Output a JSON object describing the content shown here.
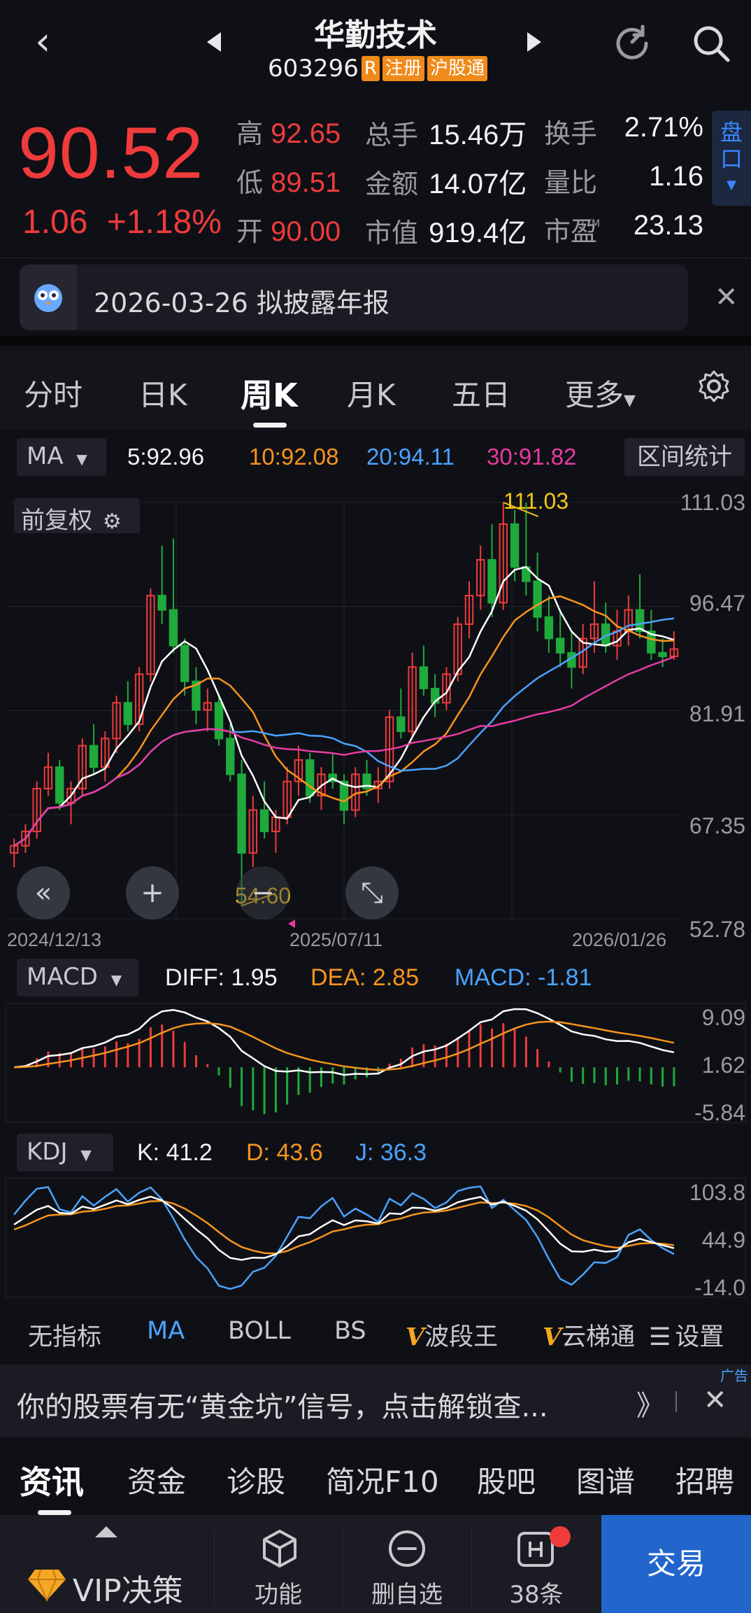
{
  "header": {
    "stock_name": "华勤技术",
    "stock_code": "603296",
    "badges": {
      "r": "R",
      "reg": "注册",
      "hk": "沪股通"
    }
  },
  "quote": {
    "price": "90.52",
    "change": "1.06",
    "change_pct": "+1.18%",
    "high_label": "高",
    "high": "92.65",
    "low_label": "低",
    "low": "89.51",
    "open_label": "开",
    "open": "90.00",
    "volume_label": "总手",
    "volume": "15.46万",
    "amount_label": "金额",
    "amount": "14.07亿",
    "mcap_label": "市值",
    "mcap": "919.4亿",
    "turnover_label": "换手",
    "turnover": "2.71%",
    "vol_ratio_label": "量比",
    "vol_ratio": "1.16",
    "pe_label": "市盈",
    "pe_sup": "TTM",
    "pe": "23.13",
    "pankou": "盘口"
  },
  "notice": {
    "text": "2026-03-26 拟披露年报"
  },
  "chart_tabs": [
    "分时",
    "日K",
    "周K",
    "月K",
    "五日",
    "更多"
  ],
  "active_tab": "周K",
  "ma": {
    "select": "MA",
    "ma5": "5:92.96",
    "ma10": "10:92.08",
    "ma20": "20:94.11",
    "ma30": "30:91.82",
    "range_stat": "区间统计"
  },
  "kline": {
    "adjust_label": "前复权",
    "price_ticks": [
      "111.03",
      "96.47",
      "81.91",
      "67.35",
      "52.78"
    ],
    "dates": [
      "2024/12/13",
      "2025/07/11",
      "2026/01/26"
    ],
    "max_label": "111.03",
    "min_label": "54.60"
  },
  "macd": {
    "select": "MACD",
    "diff": "DIFF: 1.95",
    "dea": "DEA: 2.85",
    "macd": "MACD: -1.81",
    "ticks": [
      "9.09",
      "1.62",
      "-5.84"
    ]
  },
  "kdj": {
    "select": "KDJ",
    "k": "K: 41.2",
    "d": "D: 43.6",
    "j": "J: 36.3",
    "ticks": [
      "103.8",
      "44.9",
      "-14.0"
    ]
  },
  "indicators": [
    "无指标",
    "MA",
    "BOLL",
    "BS",
    "波段王",
    "云梯通",
    "设置"
  ],
  "ad": {
    "tag": "广告",
    "text": "你的股票有无“黄金坑”信号，点击解锁查...",
    "more": "》"
  },
  "info_tabs": [
    "资讯",
    "资金",
    "诊股",
    "简况F10",
    "股吧",
    "图谱",
    "招聘"
  ],
  "bottom": {
    "vip": "VIP决策",
    "func": "功能",
    "remove": "删自选",
    "msgs": "38条",
    "trade": "交易"
  },
  "colors": {
    "up": "#ef3b3b",
    "down": "#1faa3c",
    "ma5": "#ffffff",
    "ma10": "#f7941d",
    "ma20": "#4aa3ff",
    "ma30": "#e63ca0"
  },
  "chart_data": {
    "type": "candlestick",
    "title": "",
    "xlabel": "",
    "ylabel": "",
    "ylim": [
      52.78,
      111.03
    ],
    "x_ticks": [
      "2024/12/13",
      "2025/07/11",
      "2026/01/26"
    ],
    "candles": [
      [
        62,
        64,
        60,
        63
      ],
      [
        63,
        66,
        62,
        65
      ],
      [
        65,
        72,
        64,
        71
      ],
      [
        71,
        76,
        70,
        74
      ],
      [
        74,
        75,
        68,
        69
      ],
      [
        69,
        72,
        66,
        71
      ],
      [
        71,
        78,
        70,
        77
      ],
      [
        77,
        80,
        73,
        74
      ],
      [
        74,
        79,
        72,
        78
      ],
      [
        78,
        84,
        76,
        83
      ],
      [
        83,
        86,
        79,
        80
      ],
      [
        80,
        88,
        79,
        87
      ],
      [
        87,
        99,
        86,
        98
      ],
      [
        98,
        105,
        94,
        96
      ],
      [
        96,
        106,
        90,
        91
      ],
      [
        91,
        92,
        84,
        86
      ],
      [
        86,
        88,
        80,
        82
      ],
      [
        82,
        85,
        79,
        83
      ],
      [
        83,
        84,
        77,
        78
      ],
      [
        78,
        80,
        72,
        73
      ],
      [
        73,
        75,
        54.6,
        62
      ],
      [
        62,
        70,
        60,
        68
      ],
      [
        68,
        72,
        64,
        65
      ],
      [
        65,
        68,
        62,
        67
      ],
      [
        67,
        74,
        66,
        72
      ],
      [
        72,
        77,
        70,
        75
      ],
      [
        75,
        76,
        69,
        70
      ],
      [
        70,
        74,
        68,
        73
      ],
      [
        73,
        76,
        71,
        72
      ],
      [
        72,
        73,
        66,
        68
      ],
      [
        68,
        74,
        67,
        73
      ],
      [
        73,
        75,
        70,
        71
      ],
      [
        71,
        74,
        69,
        72
      ],
      [
        72,
        82,
        71,
        81
      ],
      [
        81,
        85,
        78,
        79
      ],
      [
        79,
        90,
        78,
        88
      ],
      [
        88,
        91,
        84,
        85
      ],
      [
        85,
        87,
        81,
        83
      ],
      [
        83,
        88,
        82,
        87
      ],
      [
        87,
        95,
        86,
        94
      ],
      [
        94,
        100,
        92,
        98
      ],
      [
        98,
        105,
        96,
        103
      ],
      [
        103,
        108,
        95,
        97
      ],
      [
        97,
        111.03,
        96,
        108
      ],
      [
        108,
        110,
        100,
        102
      ],
      [
        102,
        111,
        98,
        100
      ],
      [
        100,
        104,
        93,
        95
      ],
      [
        95,
        98,
        90,
        92
      ],
      [
        92,
        96,
        88,
        90
      ],
      [
        90,
        93,
        85,
        88
      ],
      [
        88,
        94,
        87,
        92
      ],
      [
        92,
        100,
        90,
        94
      ],
      [
        94,
        97,
        90,
        91
      ],
      [
        91,
        96,
        89,
        93
      ],
      [
        93,
        98,
        91,
        96
      ],
      [
        96,
        101,
        92,
        93
      ],
      [
        93,
        96,
        89,
        90
      ],
      [
        90,
        92,
        88,
        89.5
      ],
      [
        89.5,
        93,
        89,
        90.52
      ]
    ],
    "ma5_last": 92.96,
    "ma10_last": 92.08,
    "ma20_last": 94.11,
    "ma30_last": 91.82
  }
}
